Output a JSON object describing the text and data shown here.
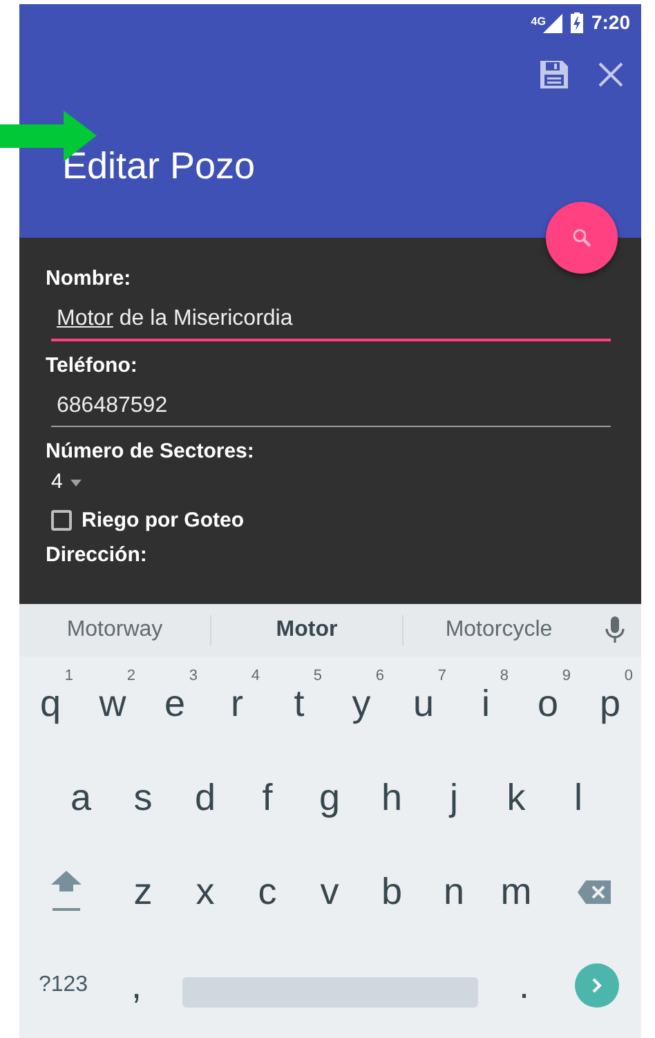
{
  "status_bar": {
    "network": "4G",
    "time": "7:20"
  },
  "toolbar": {
    "title": "Editar Pozo"
  },
  "form": {
    "fields": [
      {
        "kind": "text",
        "label": "Nombre:",
        "focused": true,
        "value_parts": [
          {
            "text": "Motor",
            "composing": true
          },
          {
            "text": "de la Misericordia",
            "composing": false
          }
        ]
      },
      {
        "kind": "text",
        "label": "Teléfono:",
        "focused": false,
        "value_parts": [
          {
            "text": "686487592",
            "composing": false
          }
        ]
      },
      {
        "kind": "spinner",
        "label": "Número de Sectores:",
        "value": "4"
      },
      {
        "kind": "checkbox",
        "label": "Riego por Goteo",
        "checked": false
      },
      {
        "kind": "heading",
        "label": "Dirección:"
      }
    ]
  },
  "keyboard": {
    "suggestions": [
      {
        "text": "Motorway",
        "selected": false
      },
      {
        "text": "Motor",
        "selected": true
      },
      {
        "text": "Motorcycle",
        "selected": false
      }
    ],
    "rows": [
      {
        "keys": [
          {
            "kind": "letter",
            "label": "q",
            "hint": "1"
          },
          {
            "kind": "letter",
            "label": "w",
            "hint": "2"
          },
          {
            "kind": "letter",
            "label": "e",
            "hint": "3"
          },
          {
            "kind": "letter",
            "label": "r",
            "hint": "4"
          },
          {
            "kind": "letter",
            "label": "t",
            "hint": "5"
          },
          {
            "kind": "letter",
            "label": "y",
            "hint": "6"
          },
          {
            "kind": "letter",
            "label": "u",
            "hint": "7"
          },
          {
            "kind": "letter",
            "label": "i",
            "hint": "8"
          },
          {
            "kind": "letter",
            "label": "o",
            "hint": "9"
          },
          {
            "kind": "letter",
            "label": "p",
            "hint": "0"
          }
        ]
      },
      {
        "keys": [
          {
            "kind": "letter",
            "label": "a"
          },
          {
            "kind": "letter",
            "label": "s"
          },
          {
            "kind": "letter",
            "label": "d"
          },
          {
            "kind": "letter",
            "label": "f"
          },
          {
            "kind": "letter",
            "label": "g"
          },
          {
            "kind": "letter",
            "label": "h"
          },
          {
            "kind": "letter",
            "label": "j"
          },
          {
            "kind": "letter",
            "label": "k"
          },
          {
            "kind": "letter",
            "label": "l"
          }
        ]
      },
      {
        "keys": [
          {
            "kind": "shift"
          },
          {
            "kind": "letter",
            "label": "z"
          },
          {
            "kind": "letter",
            "label": "x"
          },
          {
            "kind": "letter",
            "label": "c"
          },
          {
            "kind": "letter",
            "label": "v"
          },
          {
            "kind": "letter",
            "label": "b"
          },
          {
            "kind": "letter",
            "label": "n"
          },
          {
            "kind": "letter",
            "label": "m"
          },
          {
            "kind": "backspace"
          }
        ]
      },
      {
        "keys": [
          {
            "kind": "symbols",
            "label": "?123"
          },
          {
            "kind": "punct",
            "label": ","
          },
          {
            "kind": "space"
          },
          {
            "kind": "punct",
            "label": "."
          },
          {
            "kind": "enter"
          }
        ]
      }
    ]
  }
}
